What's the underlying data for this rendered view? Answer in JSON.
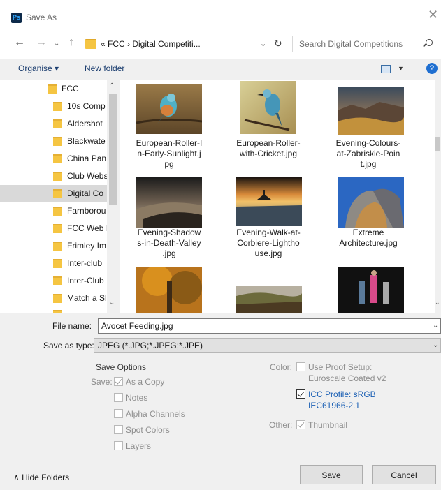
{
  "window": {
    "title": "Save As",
    "app_icon_text": "Ps",
    "close_glyph": "✕"
  },
  "nav": {
    "back_glyph": "←",
    "forward_glyph": "→",
    "recent_glyph": "⌄",
    "up_glyph": "↑",
    "address_text": "« FCC  ›  Digital Competiti...",
    "address_dropdown_glyph": "⌄",
    "refresh_glyph": "↻",
    "search_placeholder": "Search Digital Competitions"
  },
  "toolbar": {
    "organise_label": "Organise ▾",
    "new_folder_label": "New folder",
    "view_dropdown_glyph": "▼",
    "help_glyph": "?"
  },
  "sidebar": {
    "items": [
      {
        "label": "FCC",
        "selected": false
      },
      {
        "label": "10s Comp",
        "selected": false
      },
      {
        "label": "Aldershot",
        "selected": false
      },
      {
        "label": "Blackwate",
        "selected": false
      },
      {
        "label": "China Pan",
        "selected": false
      },
      {
        "label": "Club Webs",
        "selected": false
      },
      {
        "label": "Digital Co",
        "selected": true
      },
      {
        "label": "Farnborou",
        "selected": false
      },
      {
        "label": "FCC Web I",
        "selected": false
      },
      {
        "label": "Frimley Im",
        "selected": false
      },
      {
        "label": "Inter-club",
        "selected": false
      },
      {
        "label": "Inter-Club",
        "selected": false
      },
      {
        "label": "Match a Sl",
        "selected": false
      }
    ],
    "scroll_up_glyph": "⌃",
    "scroll_down_glyph": "⌄"
  },
  "files": [
    {
      "name": "European-Roller-In-Early-Sunlight.jpg",
      "display": "European-Roller-I\nn-Early-Sunlight.j\npg"
    },
    {
      "name": "European-Roller-with-Cricket.jpg",
      "display": "European-Roller-\nwith-Cricket.jpg"
    },
    {
      "name": "Evening-Colours-at-Zabriskie-Point.jpg",
      "display": "Evening-Colours-\nat-Zabriskie-Poin\nt.jpg"
    },
    {
      "name": "Evening-Shadows-in-Death-Valley.jpg",
      "display": "Evening-Shadow\ns-in-Death-Valley\n.jpg"
    },
    {
      "name": "Evening-Walk-at-Corbiere-Lighthouse.jpg",
      "display": "Evening-Walk-at-\nCorbiere-Lightho\nuse.jpg"
    },
    {
      "name": "Extreme Architecture.jpg",
      "display": "Extreme\nArchitecture.jpg"
    },
    {
      "name": "",
      "display": ""
    },
    {
      "name": "",
      "display": ""
    },
    {
      "name": "",
      "display": ""
    }
  ],
  "form": {
    "file_name_label": "File name:",
    "file_name_value": "Avocet Feeding.jpg",
    "save_as_type_label": "Save as type:",
    "save_as_type_value": "JPEG (*.JPG;*.JPEG;*.JPE)",
    "dropdown_glyph": "⌄"
  },
  "save_options": {
    "title": "Save Options",
    "save_label": "Save:",
    "as_a_copy": "As a Copy",
    "notes": "Notes",
    "alpha_channels": "Alpha Channels",
    "spot_colors": "Spot Colors",
    "layers": "Layers",
    "color_label": "Color:",
    "use_proof_setup_line1": "Use Proof Setup:",
    "use_proof_setup_line2": "Euroscale Coated v2",
    "icc_profile_line1": "ICC Profile:  sRGB",
    "icc_profile_line2": "IEC61966-2.1",
    "other_label": "Other:",
    "thumbnail": "Thumbnail"
  },
  "footer": {
    "hide_folders": "∧  Hide Folders",
    "save_button": "Save",
    "cancel_button": "Cancel"
  }
}
